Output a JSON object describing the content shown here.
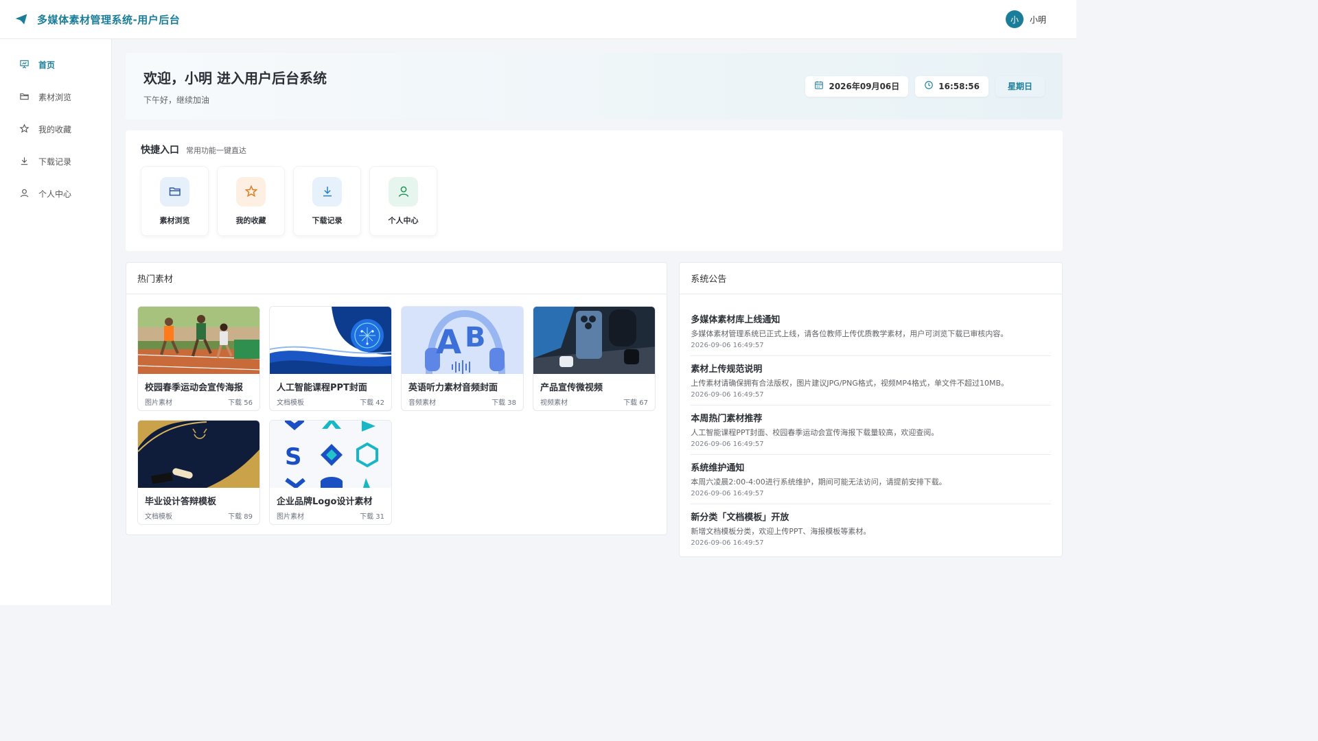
{
  "header": {
    "title": "多媒体素材管理系统-用户后台",
    "user_avatar": "小",
    "user_name": "小明"
  },
  "sidebar": {
    "items": [
      {
        "label": "首页",
        "icon": "presentation-icon",
        "active": true
      },
      {
        "label": "素材浏览",
        "icon": "folder-icon"
      },
      {
        "label": "我的收藏",
        "icon": "star-icon"
      },
      {
        "label": "下载记录",
        "icon": "download-icon"
      },
      {
        "label": "个人中心",
        "icon": "user-icon"
      }
    ]
  },
  "welcome": {
    "title": "欢迎，小明 进入用户后台系统",
    "subtitle": "下午好，继续加油",
    "date": "2026年09月06日",
    "time": "16:58:56",
    "weekday": "星期日"
  },
  "quick": {
    "title": "快捷入口",
    "subtitle": "常用功能一键直达",
    "items": [
      {
        "label": "素材浏览",
        "icon": "folder-icon",
        "bg": "#e6f0fb",
        "color": "#2c5aa0"
      },
      {
        "label": "我的收藏",
        "icon": "star-icon",
        "bg": "#fdf0e3",
        "color": "#e07a1f"
      },
      {
        "label": "下载记录",
        "icon": "download-icon",
        "bg": "#e7f1fb",
        "color": "#2b7fc4"
      },
      {
        "label": "个人中心",
        "icon": "user-icon",
        "bg": "#e6f6ee",
        "color": "#21945a"
      }
    ]
  },
  "hot": {
    "title": "热门素材",
    "items": [
      {
        "title": "校园春季运动会宣传海报",
        "category": "图片素材",
        "downloads": "下载 56"
      },
      {
        "title": "人工智能课程PPT封面",
        "category": "文档模板",
        "downloads": "下载 42"
      },
      {
        "title": "英语听力素材音频封面",
        "category": "音频素材",
        "downloads": "下载 38"
      },
      {
        "title": "产品宣传微视频",
        "category": "视频素材",
        "downloads": "下载 67"
      },
      {
        "title": "毕业设计答辩模板",
        "category": "文档模板",
        "downloads": "下载 89"
      },
      {
        "title": "企业品牌Logo设计素材",
        "category": "图片素材",
        "downloads": "下载 31"
      }
    ]
  },
  "notices": {
    "title": "系统公告",
    "items": [
      {
        "title": "多媒体素材库上线通知",
        "content": "多媒体素材管理系统已正式上线，请各位教师上传优质教学素材，用户可浏览下载已审核内容。",
        "time": "2026-09-06 16:49:57"
      },
      {
        "title": "素材上传规范说明",
        "content": "上传素材请确保拥有合法版权，图片建议JPG/PNG格式，视频MP4格式，单文件不超过10MB。",
        "time": "2026-09-06 16:49:57"
      },
      {
        "title": "本周热门素材推荐",
        "content": "人工智能课程PPT封面、校园春季运动会宣传海报下载量较高，欢迎查阅。",
        "time": "2026-09-06 16:49:57"
      },
      {
        "title": "系统维护通知",
        "content": "本周六凌晨2:00-4:00进行系统维护，期间可能无法访问，请提前安排下载。",
        "time": "2026-09-06 16:49:57"
      },
      {
        "title": "新分类「文档模板」开放",
        "content": "新增文档模板分类，欢迎上传PPT、海报模板等素材。",
        "time": "2026-09-06 16:49:57"
      }
    ]
  },
  "colors": {
    "brand": "#1a7e9a"
  }
}
